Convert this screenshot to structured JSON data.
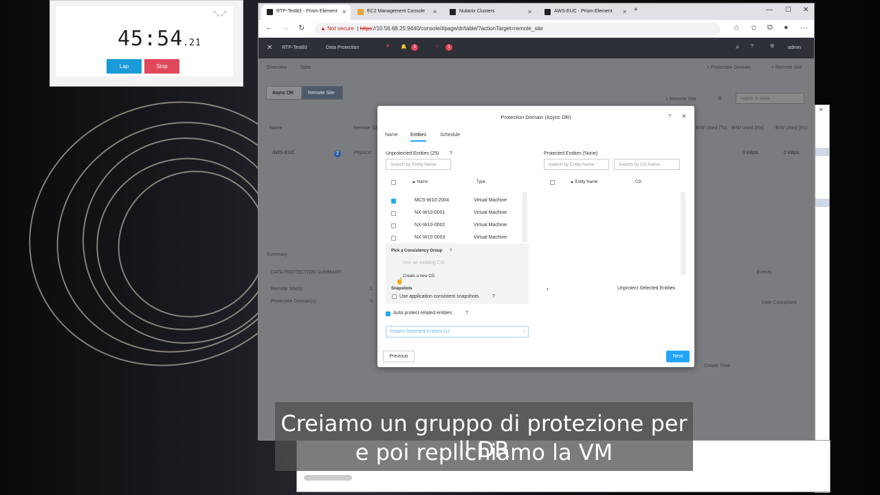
{
  "stopwatch": {
    "time": "45:54",
    "ms": ".21",
    "lap_label": "Lap",
    "stop_label": "Stop"
  },
  "browser": {
    "tabs": [
      {
        "label": "RTP-Test83 - Prism Element"
      },
      {
        "label": "EC2 Management Console"
      },
      {
        "label": "Nutanix Clusters"
      },
      {
        "label": "AWS-EUC - Prism Element"
      }
    ],
    "url_warning": "Not secure",
    "url_scheme": "https",
    "url_rest": "://10.56.68.25:9440/console/#page/dr/table/?actionTarget=remote_site"
  },
  "nutanix": {
    "cluster": "RTP-Test83",
    "menu": "Data Protection",
    "alert_count_1": "3",
    "alert_count_2": "1",
    "user": "admin",
    "breadcrumb_overview": "Overview",
    "breadcrumb_table": "Table",
    "link_protection_domain": "+ Protection Domain",
    "link_remote_site": "+ Remote Site",
    "seg_async": "Async DR",
    "seg_remote": "Remote Site",
    "remote_site_count": "1 Remote Site",
    "search_placeholder": "search in table",
    "col_name": "Name",
    "col_remote": "Remote Site",
    "col_bw_tx": "B/W Used (Tx)",
    "col_bw_rx": "B/W Used (Rx)",
    "col_bw_used": "B/W Used (Rx)",
    "row_site": "AWS-EUC",
    "row_site_badge": "2",
    "row_type": "Physical",
    "row_kbps1": "0 KBps",
    "row_kbps2": "0 KBps",
    "summary_label": "Summary",
    "dps_title": "DATA PROTECTION SUMMARY",
    "dps_remote_label": "Remote Site(s)",
    "dps_remote_value": "1",
    "dps_pd_label": "Protection Domain(s)",
    "dps_pd_value": "5",
    "events_label": "Events",
    "date_completed": "Date Completed",
    "create_time": "Create Time"
  },
  "modal": {
    "title": "Protection Domain (Async DR)",
    "help": "?",
    "close": "×",
    "tabs": [
      "Name",
      "Entities",
      "Schedule"
    ],
    "unprotected_title": "Unprotected Entities (25)",
    "search_entity_placeholder": "Search by Entity Name",
    "col_name": "Name",
    "col_type": "Type",
    "rows": [
      {
        "name": "MCS-W10-2004",
        "type": "Virtual Machine",
        "checked": true
      },
      {
        "name": "NX-W10-0001",
        "type": "Virtual Machine",
        "checked": false
      },
      {
        "name": "NX-W10-0002",
        "type": "Virtual Machine",
        "checked": false
      },
      {
        "name": "NX-W10-0003",
        "type": "Virtual Machine",
        "checked": false
      }
    ],
    "pick_cg": "Pick a Consistency Group",
    "use_existing_cg": "Use an existing CG",
    "create_new_cg": "Create a new CG",
    "snapshots": "Snapshots",
    "app_consistent": "Use application consistent snapshots",
    "auto_protect": "Auto protect related entities.",
    "protect_selected": "Protect Selected Entities (1)",
    "protected_title": "Protected Entities (None)",
    "search_entity_placeholder_r": "Search by Entity Name",
    "search_cg_placeholder": "Search by CG Name",
    "col_entity_name": "Entity Name",
    "col_cg": "CG",
    "unprotect_selected": "Unprotect Selected Entities",
    "previous": "Previous",
    "next": "Next"
  },
  "subtitle": {
    "line1": "Creiamo un gruppo di protezione per il DR",
    "line2": "e poi replichiamo la VM"
  },
  "colors": {
    "accent": "#22a5f7",
    "lap": "#1a9ad6",
    "stop": "#e0475b",
    "nx_bar": "#2d3036"
  }
}
